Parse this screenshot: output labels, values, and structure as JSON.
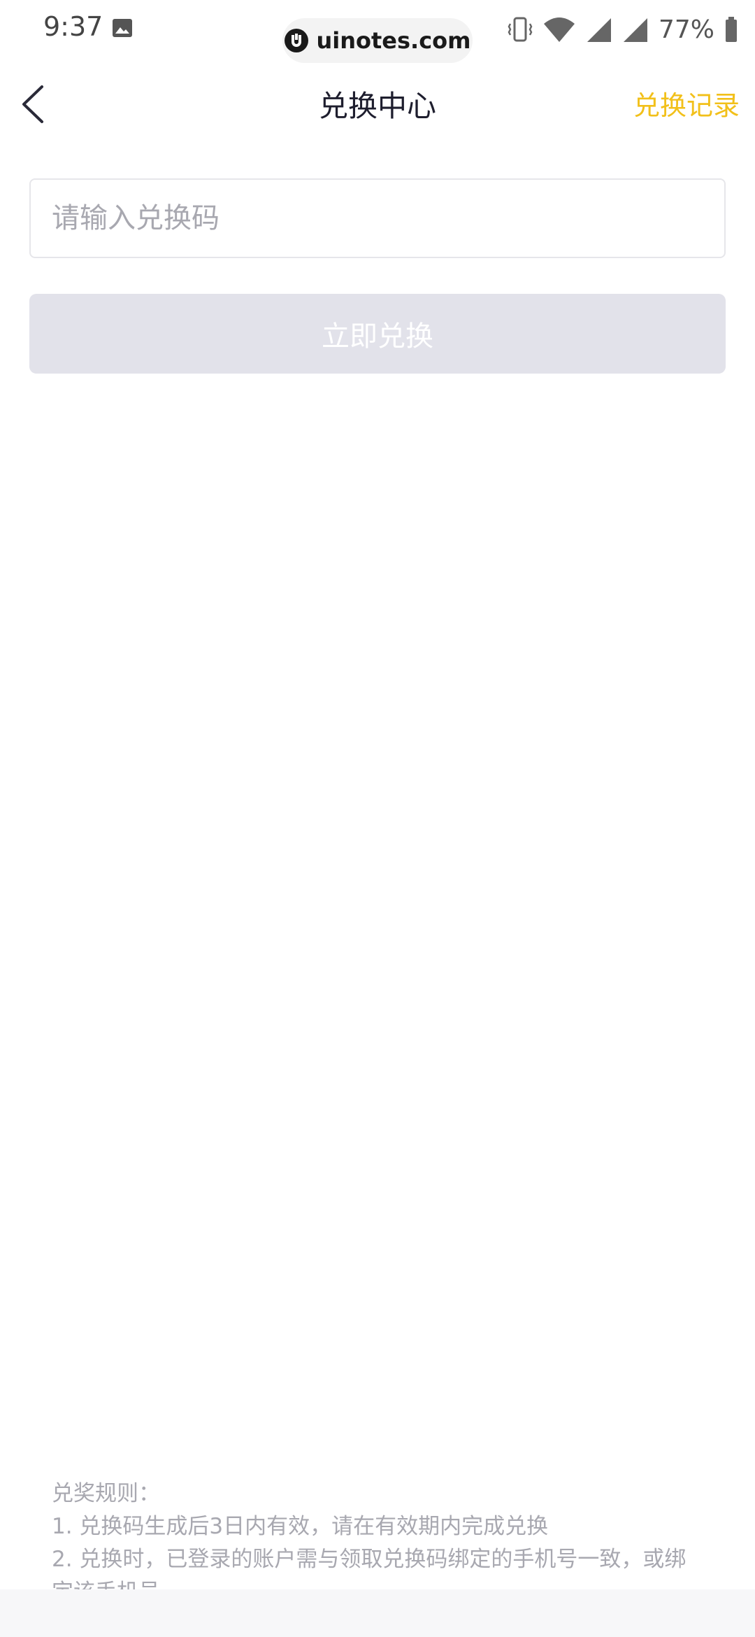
{
  "status_bar": {
    "time": "9:37",
    "battery": "77%",
    "watermark": "uinotes.com",
    "icons": [
      "image-icon",
      "vibrate-icon",
      "wifi-icon",
      "signal-icon",
      "signal-icon",
      "battery-icon"
    ]
  },
  "nav": {
    "title": "兑换中心",
    "records_label": "兑换记录",
    "accent_color": "#f2c01a"
  },
  "form": {
    "input_placeholder": "请输入兑换码",
    "input_value": "",
    "submit_label": "立即兑换",
    "submit_disabled_color": "#e2e2ea"
  },
  "rules": {
    "title": "兑奖规则：",
    "items": [
      "1. 兑换码生成后3日内有效，请在有效期内完成兑换",
      "2. 兑换时，已登录的账户需与领取兑换码绑定的手机号一致，或绑",
      "定该手机号"
    ]
  }
}
